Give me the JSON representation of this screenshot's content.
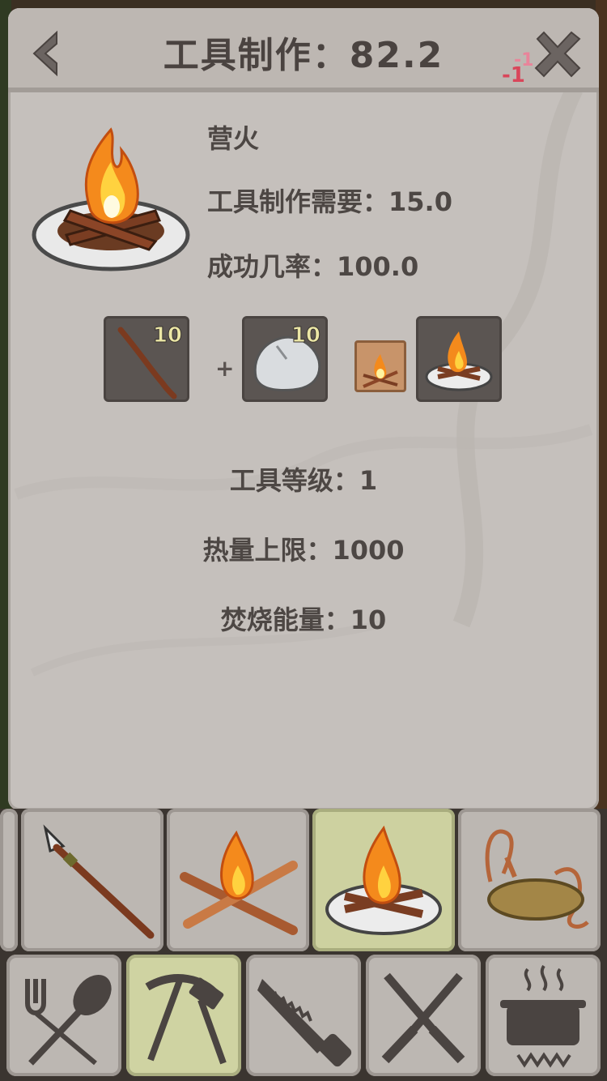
{
  "header": {
    "title": "工具制作：82.2",
    "badge_text": "-1",
    "badge_text2": "-1"
  },
  "recipe": {
    "name": "营火",
    "skill_required": "工具制作需要：15.0",
    "success_rate": "成功几率：100.0",
    "ingredients": [
      {
        "name": "stick",
        "count": "10"
      },
      {
        "name": "stone",
        "count": "10"
      }
    ],
    "plus_sign": "+",
    "tool_level": "工具等级：1",
    "heat_limit": "热量上限：1000",
    "burn_energy": "焚烧能量：10"
  },
  "items": [
    {
      "name": "spear-icon"
    },
    {
      "name": "crossed-sticks-fire-icon"
    },
    {
      "name": "campfire-icon",
      "selected": true
    },
    {
      "name": "rope-sling-icon"
    }
  ],
  "categories": [
    {
      "name": "fork-spoon-icon"
    },
    {
      "name": "pickaxe-hammer-icon",
      "selected": true
    },
    {
      "name": "saw-icon"
    },
    {
      "name": "crossed-knives-icon"
    },
    {
      "name": "cooking-pot-icon"
    }
  ],
  "colors": {
    "panel": "#c5c0bc",
    "text": "#4d4744",
    "selected": "#cdd1a0",
    "count": "#ece7a6"
  }
}
